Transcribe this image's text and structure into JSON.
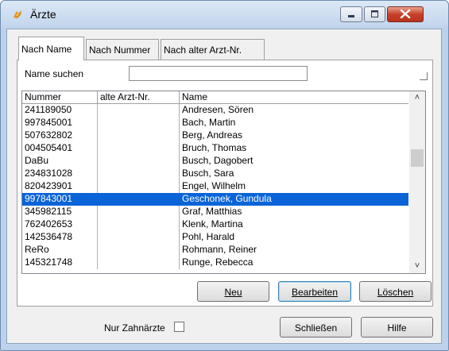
{
  "window": {
    "title": "Ärzte"
  },
  "tabs": [
    {
      "label": "Nach Name",
      "active": true
    },
    {
      "label": "Nach Nummer",
      "active": false
    },
    {
      "label": "Nach alter Arzt-Nr.",
      "active": false
    }
  ],
  "search": {
    "label": "Name suchen",
    "value": ""
  },
  "table": {
    "columns": [
      "Nummer",
      "alte Arzt-Nr.",
      "Name"
    ],
    "rows": [
      {
        "nummer": "241189050",
        "alt": "",
        "name": "Andresen, Sören"
      },
      {
        "nummer": "997845001",
        "alt": "",
        "name": "Bach, Martin"
      },
      {
        "nummer": "507632802",
        "alt": "",
        "name": "Berg, Andreas"
      },
      {
        "nummer": "004505401",
        "alt": "",
        "name": "Bruch, Thomas"
      },
      {
        "nummer": "DaBu",
        "alt": "",
        "name": "Busch, Dagobert"
      },
      {
        "nummer": "234831028",
        "alt": "",
        "name": "Busch, Sara"
      },
      {
        "nummer": "820423901",
        "alt": "",
        "name": "Engel, Wilhelm"
      },
      {
        "nummer": "997843001",
        "alt": "",
        "name": "Geschonek, Gundula",
        "selected": true
      },
      {
        "nummer": "345982115",
        "alt": "",
        "name": "Graf, Matthias"
      },
      {
        "nummer": "762402653",
        "alt": "",
        "name": "Klenk, Martina"
      },
      {
        "nummer": "142536478",
        "alt": "",
        "name": "Pohl, Harald"
      },
      {
        "nummer": "ReRo",
        "alt": "",
        "name": "Rohmann, Reiner"
      },
      {
        "nummer": "145321748",
        "alt": "",
        "name": "Runge, Rebecca"
      }
    ]
  },
  "buttons": {
    "neu": "Neu",
    "bearbeiten": "Bearbeiten",
    "loeschen": "Löschen",
    "schliessen": "Schließen",
    "hilfe": "Hilfe"
  },
  "filter": {
    "label": "Nur Zahnärzte",
    "checked": false
  },
  "colors": {
    "selection": "#0a64d8",
    "close_button": "#c7412a"
  }
}
